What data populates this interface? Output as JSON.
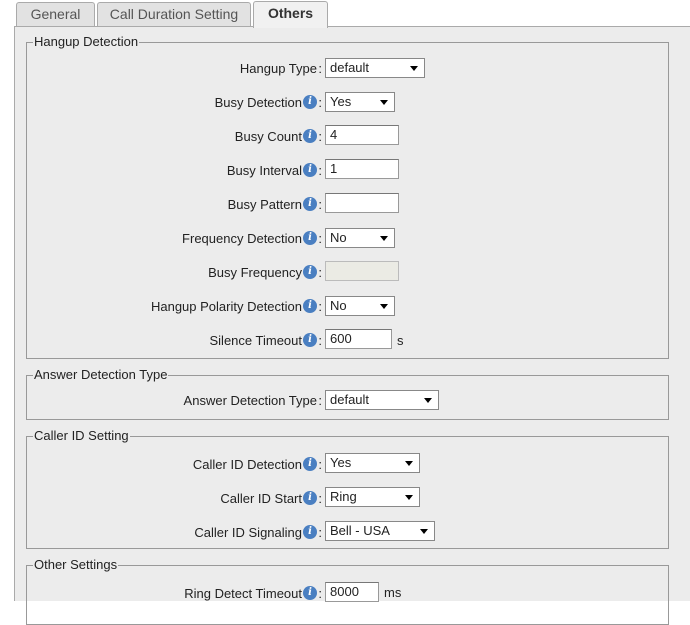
{
  "tabs": [
    {
      "label": "General",
      "active": false
    },
    {
      "label": "Call Duration Setting",
      "active": false
    },
    {
      "label": "Others",
      "active": true
    }
  ],
  "hangup": {
    "legend": "Hangup Detection",
    "hangup_type": {
      "label": "Hangup Type",
      "value": "default"
    },
    "busy_detection": {
      "label": "Busy Detection",
      "value": "Yes"
    },
    "busy_count": {
      "label": "Busy Count",
      "value": "4"
    },
    "busy_interval": {
      "label": "Busy Interval",
      "value": "1"
    },
    "busy_pattern": {
      "label": "Busy Pattern",
      "value": ""
    },
    "frequency_detection": {
      "label": "Frequency Detection",
      "value": "No"
    },
    "busy_frequency": {
      "label": "Busy Frequency",
      "value": ""
    },
    "polarity_detection": {
      "label": "Hangup Polarity Detection",
      "value": "No"
    },
    "silence_timeout": {
      "label": "Silence Timeout",
      "value": "600",
      "unit": "s"
    }
  },
  "answer": {
    "legend": "Answer Detection Type",
    "answer_type": {
      "label": "Answer Detection Type",
      "value": "default"
    }
  },
  "callerid": {
    "legend": "Caller ID Setting",
    "detection": {
      "label": "Caller ID Detection",
      "value": "Yes"
    },
    "start": {
      "label": "Caller ID Start",
      "value": "Ring"
    },
    "signaling": {
      "label": "Caller ID Signaling",
      "value": "Bell - USA"
    }
  },
  "other": {
    "legend": "Other Settings",
    "ring_timeout": {
      "label": "Ring Detect Timeout",
      "value": "8000",
      "unit": "ms"
    }
  },
  "colors": {
    "info_icon": "#4a7fc1",
    "panel_bg": "#ececec",
    "border": "#999999"
  },
  "icons": {
    "info": "info-icon",
    "dropdown": "chevron-down-icon"
  }
}
